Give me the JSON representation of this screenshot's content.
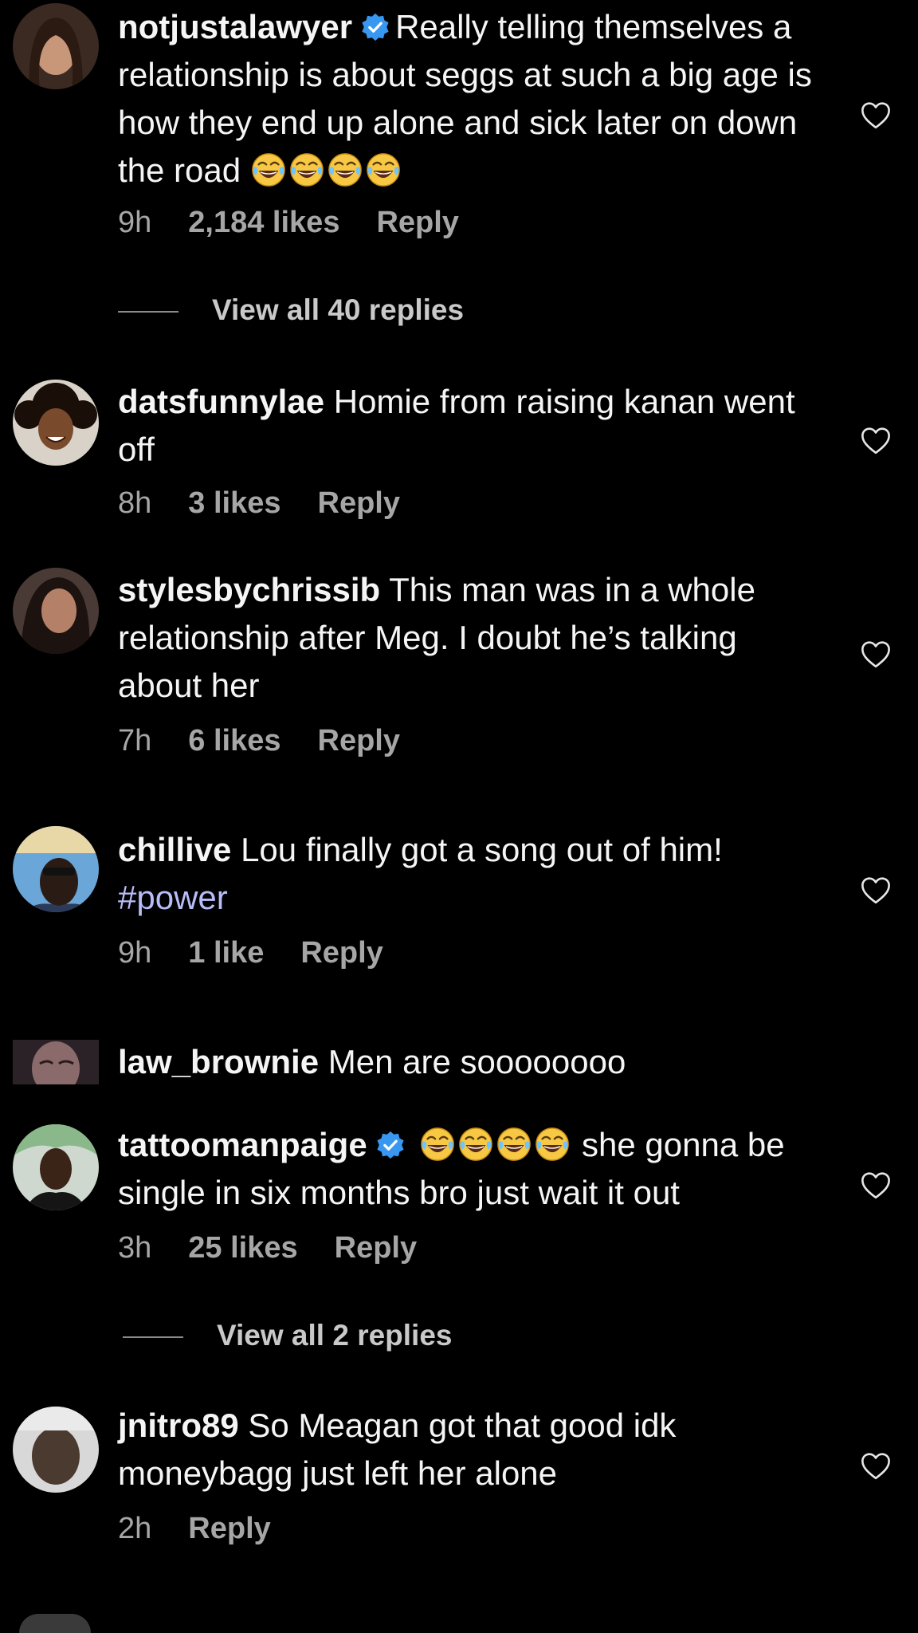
{
  "comments": [
    {
      "username": "notjustalawyer",
      "verified": true,
      "text": "Really telling themselves a relationship is about seggs at such a big age is how they end up alone and sick later on down the road",
      "emoji_count": 4,
      "time": "9h",
      "likes": "2,184 likes",
      "reply": "Reply",
      "view_replies": "View all 40 replies"
    },
    {
      "username": "datsfunnylae",
      "text": "Homie from raising kanan went off",
      "time": "8h",
      "likes": "3 likes",
      "reply": "Reply"
    },
    {
      "username": "stylesbychrissib",
      "text": "This man was in a whole relationship after Meg. I doubt he’s talking about her",
      "time": "7h",
      "likes": "6 likes",
      "reply": "Reply"
    },
    {
      "username": "chillive",
      "text": "Lou finally got a song out of him!",
      "hashtag": "#power",
      "time": "9h",
      "likes": "1 like",
      "reply": "Reply"
    },
    {
      "username": "law_brownie",
      "text": "Men are soooooooo"
    },
    {
      "username": "tattoomanpaige",
      "verified": true,
      "emoji_count": 4,
      "text": "she gonna be single in six months bro just wait it out",
      "time": "3h",
      "likes": "25 likes",
      "reply": "Reply",
      "view_replies": "View all 2 replies"
    },
    {
      "username": "jnitro89",
      "text": "So Meagan got that good idk moneybagg just left her alone",
      "time": "2h",
      "reply": "Reply"
    }
  ],
  "icons": {
    "like": "heart-outline-icon",
    "verified": "verified-badge-icon",
    "emoji": "face-with-tears-of-joy"
  },
  "colors": {
    "background": "#000000",
    "verified": "#3897f0",
    "hashtag": "#b7bdf8",
    "meta": "#a6a6a6"
  }
}
